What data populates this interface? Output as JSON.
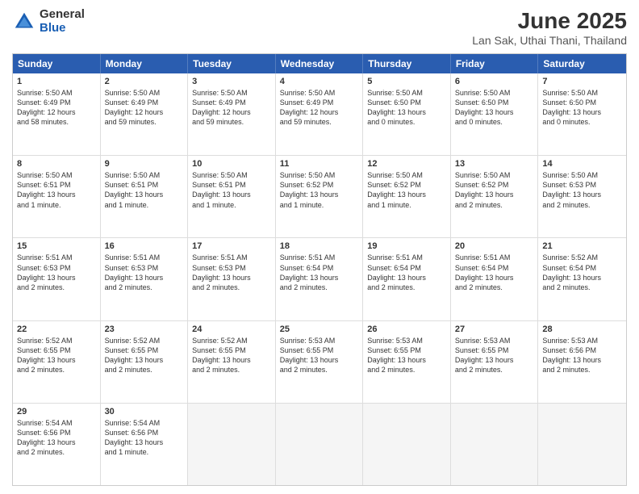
{
  "logo": {
    "general": "General",
    "blue": "Blue"
  },
  "title": "June 2025",
  "location": "Lan Sak, Uthai Thani, Thailand",
  "header": {
    "days": [
      "Sunday",
      "Monday",
      "Tuesday",
      "Wednesday",
      "Thursday",
      "Friday",
      "Saturday"
    ]
  },
  "rows": [
    [
      {
        "day": "",
        "empty": true
      },
      {
        "day": "2",
        "info": "Sunrise: 5:50 AM\nSunset: 6:49 PM\nDaylight: 12 hours\nand 59 minutes."
      },
      {
        "day": "3",
        "info": "Sunrise: 5:50 AM\nSunset: 6:49 PM\nDaylight: 12 hours\nand 59 minutes."
      },
      {
        "day": "4",
        "info": "Sunrise: 5:50 AM\nSunset: 6:49 PM\nDaylight: 12 hours\nand 59 minutes."
      },
      {
        "day": "5",
        "info": "Sunrise: 5:50 AM\nSunset: 6:50 PM\nDaylight: 13 hours\nand 0 minutes."
      },
      {
        "day": "6",
        "info": "Sunrise: 5:50 AM\nSunset: 6:50 PM\nDaylight: 13 hours\nand 0 minutes."
      },
      {
        "day": "7",
        "info": "Sunrise: 5:50 AM\nSunset: 6:50 PM\nDaylight: 13 hours\nand 0 minutes."
      }
    ],
    [
      {
        "day": "1",
        "info": "Sunrise: 5:50 AM\nSunset: 6:49 PM\nDaylight: 12 hours\nand 58 minutes.",
        "first_col": true
      },
      {
        "day": "9",
        "info": "Sunrise: 5:50 AM\nSunset: 6:51 PM\nDaylight: 13 hours\nand 1 minute."
      },
      {
        "day": "10",
        "info": "Sunrise: 5:50 AM\nSunset: 6:51 PM\nDaylight: 13 hours\nand 1 minute."
      },
      {
        "day": "11",
        "info": "Sunrise: 5:50 AM\nSunset: 6:52 PM\nDaylight: 13 hours\nand 1 minute."
      },
      {
        "day": "12",
        "info": "Sunrise: 5:50 AM\nSunset: 6:52 PM\nDaylight: 13 hours\nand 1 minute."
      },
      {
        "day": "13",
        "info": "Sunrise: 5:50 AM\nSunset: 6:52 PM\nDaylight: 13 hours\nand 2 minutes."
      },
      {
        "day": "14",
        "info": "Sunrise: 5:50 AM\nSunset: 6:53 PM\nDaylight: 13 hours\nand 2 minutes."
      }
    ],
    [
      {
        "day": "8",
        "info": "Sunrise: 5:50 AM\nSunset: 6:51 PM\nDaylight: 13 hours\nand 1 minute.",
        "first_col": true
      },
      {
        "day": "16",
        "info": "Sunrise: 5:51 AM\nSunset: 6:53 PM\nDaylight: 13 hours\nand 2 minutes."
      },
      {
        "day": "17",
        "info": "Sunrise: 5:51 AM\nSunset: 6:53 PM\nDaylight: 13 hours\nand 2 minutes."
      },
      {
        "day": "18",
        "info": "Sunrise: 5:51 AM\nSunset: 6:54 PM\nDaylight: 13 hours\nand 2 minutes."
      },
      {
        "day": "19",
        "info": "Sunrise: 5:51 AM\nSunset: 6:54 PM\nDaylight: 13 hours\nand 2 minutes."
      },
      {
        "day": "20",
        "info": "Sunrise: 5:51 AM\nSunset: 6:54 PM\nDaylight: 13 hours\nand 2 minutes."
      },
      {
        "day": "21",
        "info": "Sunrise: 5:52 AM\nSunset: 6:54 PM\nDaylight: 13 hours\nand 2 minutes."
      }
    ],
    [
      {
        "day": "15",
        "info": "Sunrise: 5:51 AM\nSunset: 6:53 PM\nDaylight: 13 hours\nand 2 minutes.",
        "first_col": true
      },
      {
        "day": "23",
        "info": "Sunrise: 5:52 AM\nSunset: 6:55 PM\nDaylight: 13 hours\nand 2 minutes."
      },
      {
        "day": "24",
        "info": "Sunrise: 5:52 AM\nSunset: 6:55 PM\nDaylight: 13 hours\nand 2 minutes."
      },
      {
        "day": "25",
        "info": "Sunrise: 5:53 AM\nSunset: 6:55 PM\nDaylight: 13 hours\nand 2 minutes."
      },
      {
        "day": "26",
        "info": "Sunrise: 5:53 AM\nSunset: 6:55 PM\nDaylight: 13 hours\nand 2 minutes."
      },
      {
        "day": "27",
        "info": "Sunrise: 5:53 AM\nSunset: 6:55 PM\nDaylight: 13 hours\nand 2 minutes."
      },
      {
        "day": "28",
        "info": "Sunrise: 5:53 AM\nSunset: 6:56 PM\nDaylight: 13 hours\nand 2 minutes."
      }
    ],
    [
      {
        "day": "22",
        "info": "Sunrise: 5:52 AM\nSunset: 6:55 PM\nDaylight: 13 hours\nand 2 minutes.",
        "first_col": true
      },
      {
        "day": "30",
        "info": "Sunrise: 5:54 AM\nSunset: 6:56 PM\nDaylight: 13 hours\nand 1 minute."
      },
      {
        "day": "",
        "empty": true
      },
      {
        "day": "",
        "empty": true
      },
      {
        "day": "",
        "empty": true
      },
      {
        "day": "",
        "empty": true
      },
      {
        "day": "",
        "empty": true
      }
    ],
    [
      {
        "day": "29",
        "info": "Sunrise: 5:54 AM\nSunset: 6:56 PM\nDaylight: 13 hours\nand 2 minutes.",
        "first_col": true
      },
      {
        "day": "",
        "empty": true
      },
      {
        "day": "",
        "empty": true
      },
      {
        "day": "",
        "empty": true
      },
      {
        "day": "",
        "empty": true
      },
      {
        "day": "",
        "empty": true
      },
      {
        "day": "",
        "empty": true
      }
    ]
  ]
}
